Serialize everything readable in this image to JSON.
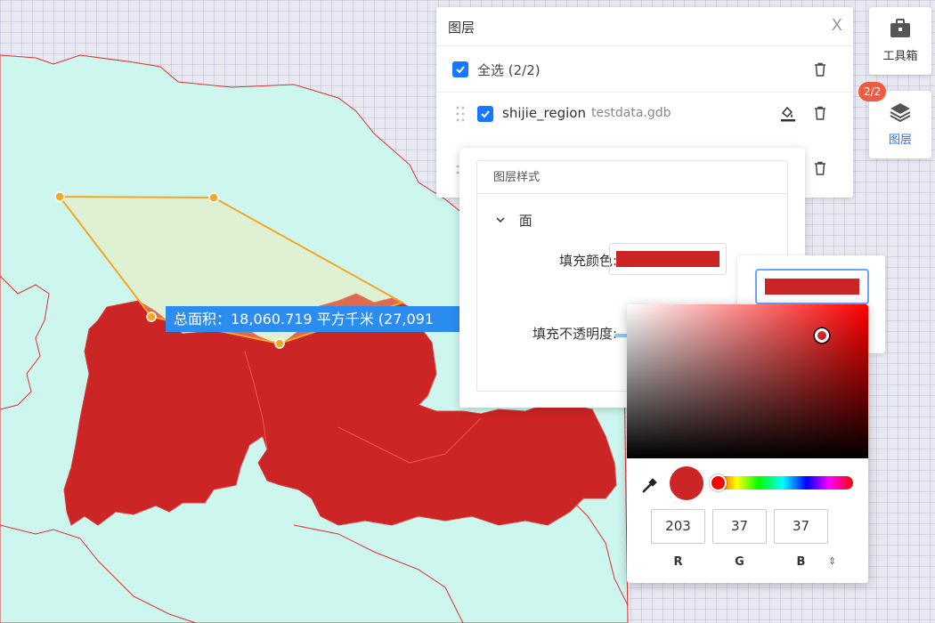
{
  "map": {
    "measure_label": "总面积：18,060.719 平方千米 (27,091",
    "land_color": "#cdf6ef",
    "region_color": "#cb2525",
    "polygon_stroke": "#f5a623"
  },
  "layer_panel": {
    "title": "图层",
    "close_label": "X",
    "select_all_label": "全选 (2/2)",
    "layers": [
      {
        "name": "shijie_region",
        "source": "testdata.gdb"
      }
    ]
  },
  "side_buttons": {
    "toolbox_label": "工具箱",
    "layers_label": "图层",
    "layers_badge": "2/2"
  },
  "style_popup": {
    "title": "图层样式",
    "section": "面",
    "fill_color_label": "填充颜色:",
    "fill_color": "#cb2525",
    "opacity_label": "填充不透明度:"
  },
  "color_picker": {
    "r": "203",
    "g": "37",
    "b": "37",
    "r_label": "R",
    "g_label": "G",
    "b_label": "B",
    "mode_toggle": "⇕"
  }
}
